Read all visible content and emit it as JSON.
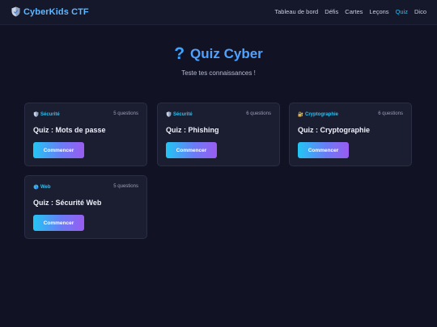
{
  "nav": {
    "brand": "CyberKids CTF",
    "links": [
      {
        "label": "Tableau de bord",
        "active": false
      },
      {
        "label": "Défis",
        "active": false
      },
      {
        "label": "Cartes",
        "active": false
      },
      {
        "label": "Leçons",
        "active": false
      },
      {
        "label": "Quiz",
        "active": true
      },
      {
        "label": "Dico",
        "active": false
      }
    ]
  },
  "hero": {
    "icon": "?",
    "title": "Quiz Cyber",
    "subtitle": "Teste tes connaissances !"
  },
  "quizzes": [
    {
      "tag": "Sécurité",
      "tag_icon": "shield-icon",
      "count": "5 questions",
      "title": "Quiz : Mots de passe",
      "button": "Commencer"
    },
    {
      "tag": "Sécurité",
      "tag_icon": "shield-icon",
      "count": "6 questions",
      "title": "Quiz : Phishing",
      "button": "Commencer"
    },
    {
      "tag": "Cryptographie",
      "tag_icon": "lock-key-icon",
      "count": "6 questions",
      "title": "Quiz : Cryptographie",
      "button": "Commencer"
    },
    {
      "tag": "Web",
      "tag_icon": "globe-icon",
      "count": "5 questions",
      "title": "Quiz : Sécurité Web",
      "button": "Commencer"
    }
  ],
  "colors": {
    "background": "#121225",
    "navbar": "#15172a",
    "card": "#1b1d31",
    "accent": "#22c4f5",
    "title_blue": "#4fa3ff",
    "button_gradient": [
      "#22c6f4",
      "#9a5cf2"
    ]
  }
}
